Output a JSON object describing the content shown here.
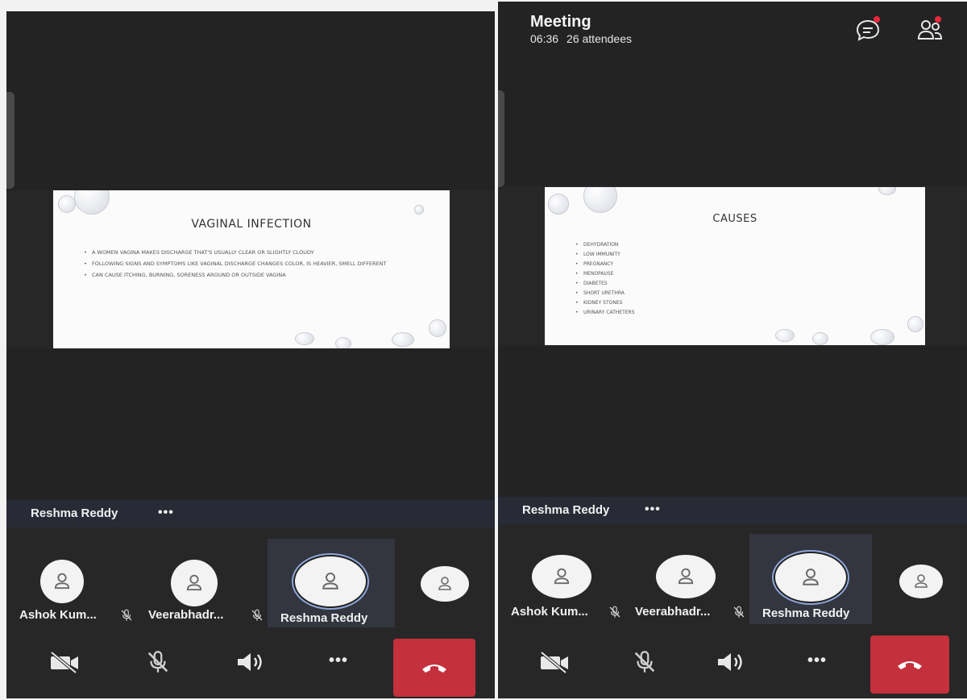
{
  "left_screen": {
    "slide": {
      "title": "VAGINAL INFECTION",
      "bullets": [
        "A women vagina makes discharge that's usually clear or slightly cloudy",
        "Following signs and symptoms like vaginal discharge changes color, is heavier, smell different",
        "Can cause itching, burning, soreness around or outside vagina"
      ]
    },
    "speaker": {
      "name": "Reshma Reddy",
      "more": "•••"
    },
    "participants": [
      {
        "name": "Ashok Kum...",
        "muted": true
      },
      {
        "name": "Veerabhadr...",
        "muted": true
      },
      {
        "name": "Reshma Reddy",
        "muted": false,
        "active": true
      },
      {
        "name": "",
        "muted": false
      }
    ],
    "controls": [
      "camera-off-icon",
      "mic-off-icon",
      "speaker-icon",
      "more-icon",
      "hang-up-icon"
    ],
    "controls_more_label": "•••"
  },
  "right_screen": {
    "header": {
      "title": "Meeting",
      "time": "06:36",
      "attendees": "26 attendees"
    },
    "slide": {
      "title": "CAUSES",
      "bullets": [
        "Dehydration",
        "Low immunity",
        "Pregnancy",
        "Menopause",
        "Diabetes",
        "Short urethra",
        "Kidney stones",
        "Urinary catheters"
      ]
    },
    "speaker": {
      "name": "Reshma Reddy",
      "more": "•••"
    },
    "participants": [
      {
        "name": "Ashok Kum...",
        "muted": true
      },
      {
        "name": "Veerabhadr...",
        "muted": true
      },
      {
        "name": "Reshma Reddy",
        "muted": false,
        "active": true
      },
      {
        "name": "",
        "muted": false
      }
    ],
    "controls_more_label": "•••"
  },
  "colors": {
    "background": "#272727",
    "hangup": "#c4303c",
    "notification": "#e8283a",
    "active_ring": "#8fa6d8"
  }
}
